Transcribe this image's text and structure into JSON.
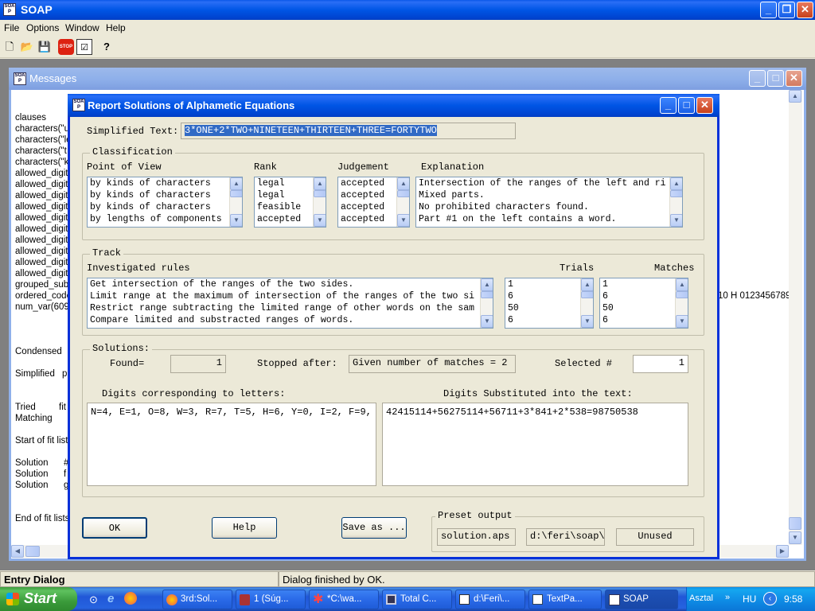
{
  "app": {
    "title": "SOAP",
    "menu": [
      "File",
      "Options",
      "Window",
      "Help"
    ]
  },
  "messages_window": {
    "title": "Messages",
    "lines": [
      "clauses",
      "characters(\"u",
      "characters(\"le",
      "characters(\"t",
      "characters(\"k",
      "allowed_digit",
      "allowed_digit",
      "allowed_digit",
      "allowed_digit",
      "allowed_digit",
      "allowed_digit",
      "allowed_digit",
      "allowed_digit",
      "allowed_digit",
      "allowed_digit",
      "grouped_subs",
      "ordered_code",
      "num_var(609"
    ],
    "right_text": "10 H 0123456789\"",
    "lower": [
      {
        "a": "Condensed",
        "b": ""
      },
      {
        "a": "Simplified",
        "b": "p"
      },
      {
        "a": "Tried",
        "b": "fit"
      },
      {
        "a": "Matching",
        "b": ""
      },
      {
        "a": "Start of fit list",
        "b": ""
      },
      {
        "a": "Solution",
        "b": "#"
      },
      {
        "a": "Solution",
        "b": "f"
      },
      {
        "a": "Solution",
        "b": "g"
      },
      {
        "a": "End of fit lists",
        "b": ""
      }
    ]
  },
  "dialog": {
    "title": "Report Solutions of Alphametic Equations",
    "simplified_label": "Simplified Text:",
    "simplified_value": "3*ONE+2*TWO+NINETEEN+THIRTEEN+THREE=FORTYTWO",
    "classification": {
      "title": "Classification",
      "headers": {
        "point_of_view": "Point of View",
        "rank": "Rank",
        "judgement": "Judgement",
        "explanation": "Explanation"
      },
      "point_of_view": [
        "by kinds of characters",
        "by kinds of characters",
        "by kinds of characters",
        "by lengths of components"
      ],
      "rank": [
        "legal",
        "legal",
        "feasible",
        "accepted"
      ],
      "judgement": [
        "accepted",
        "accepted",
        "accepted",
        "accepted"
      ],
      "explanation": [
        "Intersection of the ranges of the left and ri",
        "Mixed parts.",
        "No prohibited characters found.",
        "Part #1 on the  left contains a word."
      ]
    },
    "track": {
      "title": "Track",
      "headers": {
        "rules": "Investigated rules",
        "trials": "Trials",
        "matches": "Matches"
      },
      "rules": [
        "Get intersection of the ranges of the two sides.",
        "Limit range at the maximum of intersection of the ranges of the two si",
        "Restrict range subtracting the limited range of other words on the sam",
        "Compare limited and substracted ranges of words."
      ],
      "trials": [
        "1",
        "6",
        "50",
        "6"
      ],
      "matches": [
        "1",
        "6",
        "50",
        "6"
      ]
    },
    "solutions": {
      "title": "Solutions:",
      "found_label": "Found=",
      "found_value": "1",
      "stopped_label": "Stopped after:",
      "stopped_value": "Given number of matches = 2",
      "selected_label": "Selected #",
      "selected_value": "1",
      "digits_letters_label": "Digits corresponding to letters:",
      "digits_letters_value": "N=4, E=1, O=8, W=3, R=7, T=5, H=6, Y=0, I=2, F=9, F",
      "digits_text_label": "Digits Substituted into the text:",
      "digits_text_value": "42415114+56275114+56711+3*841+2*538=98750538"
    },
    "buttons": {
      "ok": "OK",
      "help": "Help",
      "save_as": "Save as ..."
    },
    "preset": {
      "title": "Preset output",
      "file": "solution.aps",
      "path": "d:\\feri\\soap\\",
      "status": "Unused"
    }
  },
  "statusbar": {
    "left": "Entry Dialog",
    "right": "Dialog finished by OK."
  },
  "taskbar": {
    "start": "Start",
    "tasks": [
      "3rd:Sol...",
      "1 (Súg...",
      "*C:\\wa...",
      "Total C...",
      "d:\\Feri\\...",
      "TextPa...",
      "SOAP"
    ],
    "tray_label": "Asztal",
    "lang": "HU",
    "clock": "9:58"
  }
}
